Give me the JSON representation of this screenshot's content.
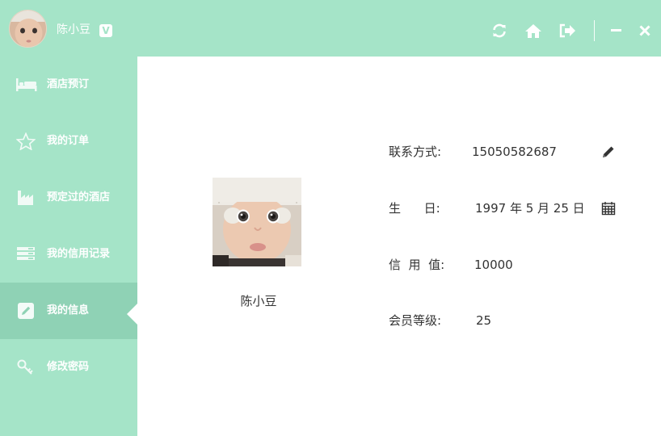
{
  "user": {
    "name": "陈小豆",
    "vip_badge": "V"
  },
  "header": {
    "icons": [
      "refresh-icon",
      "home-icon",
      "logout-icon",
      "minimize-icon",
      "close-icon"
    ]
  },
  "sidebar": {
    "items": [
      {
        "label": "酒店预订",
        "icon": "bed-icon"
      },
      {
        "label": "我的订单",
        "icon": "star-icon"
      },
      {
        "label": "预定过的酒店",
        "icon": "factory-icon"
      },
      {
        "label": "我的信用记录",
        "icon": "list-icon"
      },
      {
        "label": "我的信息",
        "icon": "edit-icon",
        "active": true
      },
      {
        "label": "修改密码",
        "icon": "key-icon"
      }
    ]
  },
  "profile": {
    "name": "陈小豆",
    "fields": [
      {
        "label": "联系方式:",
        "value": "15050582687",
        "icon": "pencil-icon"
      },
      {
        "label": "生      日:",
        "value": "1997 年 5 月 25 日",
        "icon": "calendar-icon"
      },
      {
        "label": "信  用  值:",
        "value": "10000"
      },
      {
        "label": "会员等级:",
        "value": "25"
      }
    ]
  },
  "colors": {
    "accent": "#a5e4c8",
    "active": "#8fd2b5",
    "text": "#333333"
  }
}
